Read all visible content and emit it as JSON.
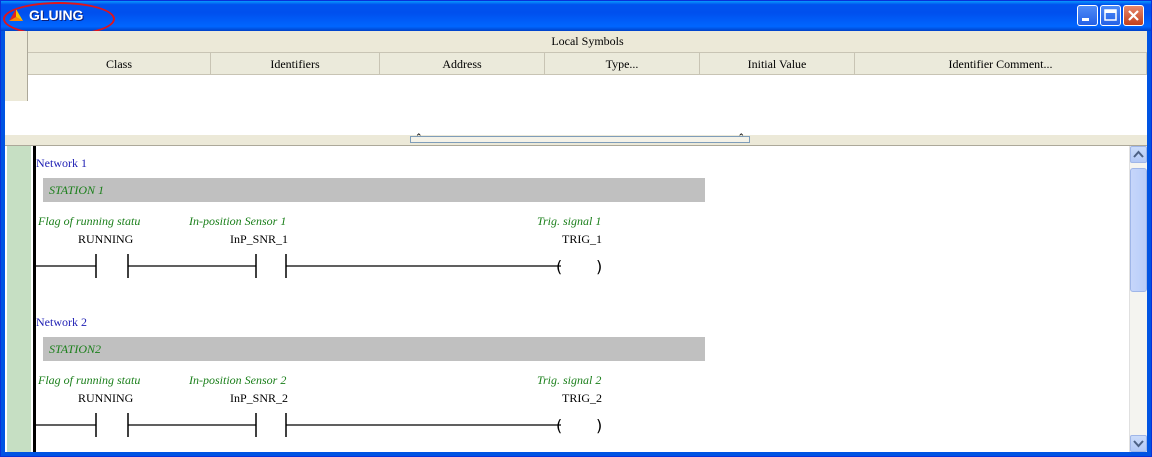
{
  "window": {
    "title": "GLUING",
    "buttons": {
      "minimize": "minimize",
      "maximize": "maximize",
      "close": "close"
    }
  },
  "symbols": {
    "title": "Local Symbols",
    "columns": [
      "Class",
      "Identifiers",
      "Address",
      "Type...",
      "Initial Value",
      "Identifier Comment..."
    ]
  },
  "networks": [
    {
      "label": "Network 1",
      "comment": "STATION 1",
      "contacts": [
        {
          "comment": "Flag of running statu",
          "var": "RUNNING"
        },
        {
          "comment": "In-position Sensor 1",
          "var": "InP_SNR_1"
        }
      ],
      "coil": {
        "comment": "Trig. signal 1",
        "var": "TRIG_1"
      }
    },
    {
      "label": "Network 2",
      "comment": "STATION2",
      "contacts": [
        {
          "comment": "Flag of running statu",
          "var": "RUNNING"
        },
        {
          "comment": "In-position Sensor 2",
          "var": "InP_SNR_2"
        }
      ],
      "coil": {
        "comment": "Trig. signal 2",
        "var": "TRIG_2"
      }
    }
  ],
  "colors": {
    "comment": "#1a7f1a",
    "network_label": "#1f1fb4",
    "highlight": "#e0141b",
    "titlebar": "#0054e3"
  },
  "icons": {
    "app": "app-logo-icon",
    "scroll_up": "chevron-up-icon",
    "scroll_down": "chevron-down-icon"
  }
}
